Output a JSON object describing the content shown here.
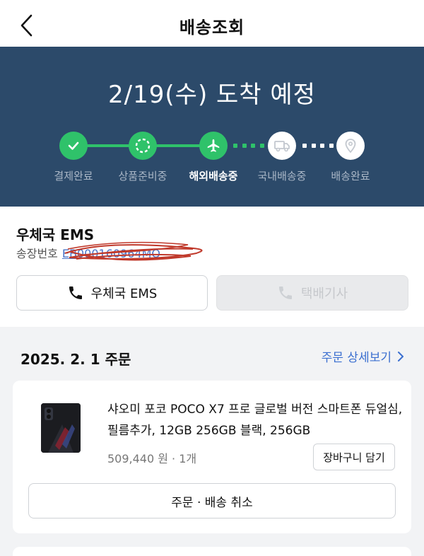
{
  "header": {
    "title": "배송조회",
    "back_icon": "chevron-left-icon"
  },
  "status": {
    "headline": "2/19(수) 도착 예정",
    "steps": [
      {
        "label": "결제완료",
        "icon": "check-icon",
        "state": "done"
      },
      {
        "label": "상품준비중",
        "icon": "dashed-circle-icon",
        "state": "done"
      },
      {
        "label": "해외배송중",
        "icon": "airplane-icon",
        "state": "current"
      },
      {
        "label": "국내배송중",
        "icon": "truck-icon",
        "state": "pending"
      },
      {
        "label": "배송완료",
        "icon": "location-pin-icon",
        "state": "pending"
      }
    ],
    "colors": {
      "background": "#2c4a6a",
      "done": "#2fc26a",
      "pending": "#ffffff"
    }
  },
  "carrier": {
    "name": "우체국 EMS",
    "tracking_label": "송장번호",
    "tracking_number": "EB000160964MO",
    "call_carrier_label": "우체국 EMS",
    "call_courier_label": "택배기사"
  },
  "order": {
    "date_label": "2025. 2. 1 주문",
    "detail_link": "주문 상세보기",
    "item": {
      "name": "샤오미 포코 POCO X7 프로 글로벌 버전 스마트폰 듀얼심, 필름추가, 12GB 256GB 블랙, 256GB",
      "price_qty": "509,440 원 · 1개",
      "cart_button": "장바구니 담기"
    },
    "cancel_button": "주문 · 배송 취소"
  }
}
